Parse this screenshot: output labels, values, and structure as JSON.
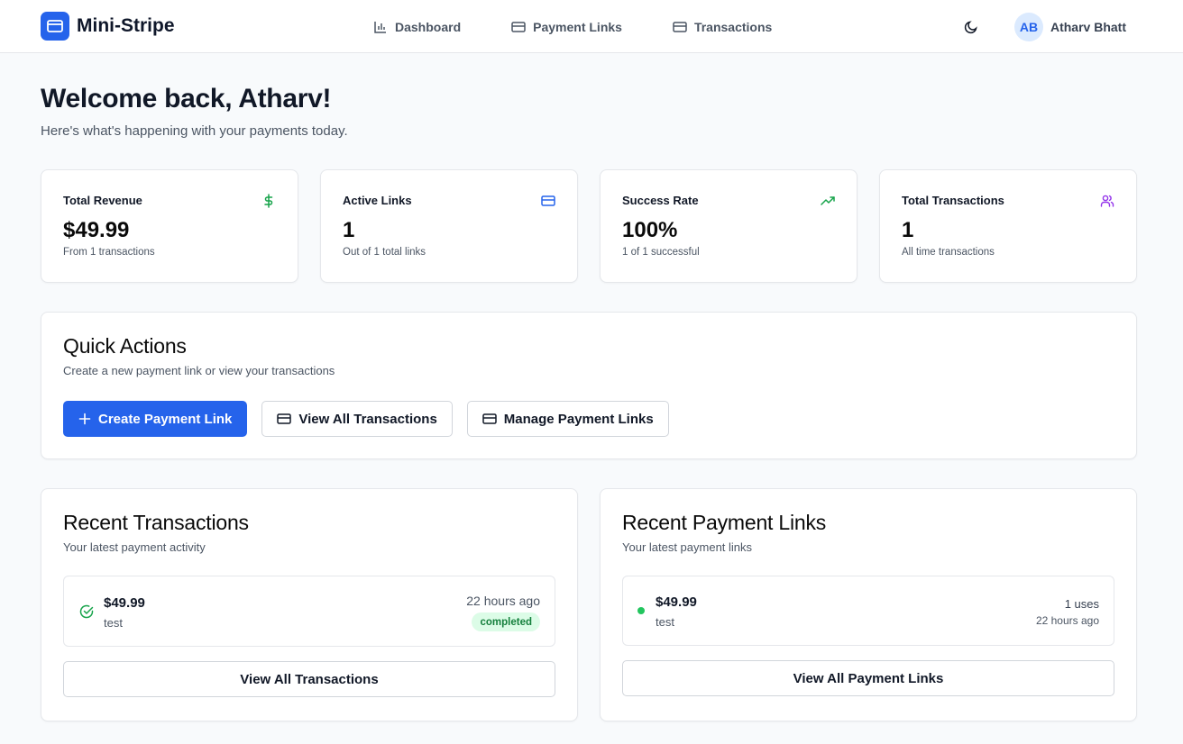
{
  "header": {
    "brand": "Mini-Stripe",
    "nav": [
      {
        "label": "Dashboard",
        "icon": "bar-chart-icon"
      },
      {
        "label": "Payment Links",
        "icon": "credit-card-icon"
      },
      {
        "label": "Transactions",
        "icon": "credit-card-icon"
      }
    ],
    "theme_icon": "moon-icon",
    "user": {
      "initials": "AB",
      "name": "Atharv Bhatt"
    }
  },
  "welcome": {
    "title": "Welcome back, Atharv!",
    "subtitle": "Here's what's happening with your payments today."
  },
  "stats": [
    {
      "label": "Total Revenue",
      "value": "$49.99",
      "sub": "From 1 transactions",
      "icon": "dollar-icon",
      "color": "#16a34a"
    },
    {
      "label": "Active Links",
      "value": "1",
      "sub": "Out of 1 total links",
      "icon": "credit-card-icon",
      "color": "#2563eb"
    },
    {
      "label": "Success Rate",
      "value": "100%",
      "sub": "1 of 1 successful",
      "icon": "trending-up-icon",
      "color": "#16a34a"
    },
    {
      "label": "Total Transactions",
      "value": "1",
      "sub": "All time transactions",
      "icon": "users-icon",
      "color": "#9333ea"
    }
  ],
  "quick_actions": {
    "title": "Quick Actions",
    "subtitle": "Create a new payment link or view your transactions",
    "buttons": [
      {
        "label": "Create Payment Link",
        "icon": "plus-icon"
      },
      {
        "label": "View All Transactions",
        "icon": "credit-card-icon"
      },
      {
        "label": "Manage Payment Links",
        "icon": "credit-card-icon"
      }
    ]
  },
  "recent_transactions": {
    "title": "Recent Transactions",
    "subtitle": "Your latest payment activity",
    "items": [
      {
        "amount": "$49.99",
        "description": "test",
        "time": "22 hours ago",
        "status": "completed"
      }
    ],
    "button": "View All Transactions"
  },
  "recent_links": {
    "title": "Recent Payment Links",
    "subtitle": "Your latest payment links",
    "items": [
      {
        "amount": "$49.99",
        "description": "test",
        "uses": "1 uses",
        "time": "22 hours ago"
      }
    ],
    "button": "View All Payment Links"
  },
  "colors": {
    "primary": "#2563eb",
    "success": "#16a34a",
    "purple": "#9333ea",
    "background": "#f8fafc"
  }
}
